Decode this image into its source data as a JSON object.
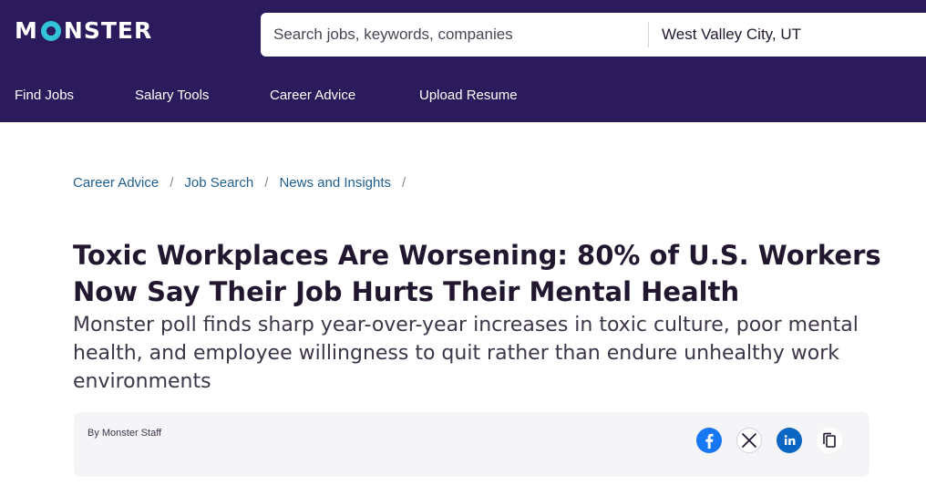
{
  "brand": {
    "logo_text_left": "M",
    "logo_text_right": "NSTER"
  },
  "search": {
    "keywords_placeholder": "Search jobs, keywords, companies",
    "location_value": "West Valley City, UT"
  },
  "nav": {
    "items": [
      {
        "label": "Find Jobs"
      },
      {
        "label": "Salary Tools"
      },
      {
        "label": "Career Advice"
      },
      {
        "label": "Upload Resume"
      }
    ]
  },
  "breadcrumb": {
    "items": [
      {
        "label": "Career Advice"
      },
      {
        "label": "Job Search"
      },
      {
        "label": "News and Insights"
      }
    ],
    "separator": "/"
  },
  "article": {
    "title": "Toxic Workplaces Are Worsening: 80% of U.S. Workers Now Say Their Job Hurts Their Mental Health",
    "subtitle": "Monster poll finds sharp year-over-year increases in toxic culture, poor mental health, and employee willingness to quit rather than endure unhealthy work environments",
    "byline": "By Monster Staff"
  },
  "share": {
    "icons": [
      "facebook-icon",
      "x-icon",
      "linkedin-icon",
      "copy-icon"
    ]
  },
  "colors": {
    "header_bg": "#2b1b5c",
    "accent_teal": "#33c3d8",
    "link": "#1f5f8f",
    "facebook": "#1877f2",
    "linkedin": "#0a66c2"
  }
}
